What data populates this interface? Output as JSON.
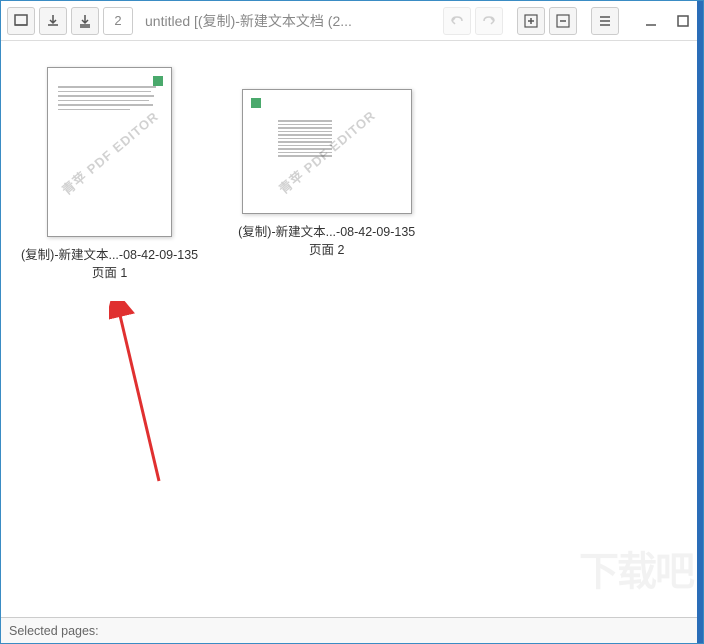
{
  "toolbar": {
    "page_number": "2",
    "title": "untitled [(复制)-新建文本文档 (2..."
  },
  "pages": [
    {
      "caption_line1": "(复制)-新建文本...-08-42-09-135",
      "caption_line2": "页面 1"
    },
    {
      "caption_line1": "(复制)-新建文本...-08-42-09-135",
      "caption_line2": "页面 2"
    }
  ],
  "watermark_text": "青苹 PDF EDITOR",
  "statusbar": {
    "label": "Selected pages:"
  },
  "bg_watermark": "下载吧"
}
